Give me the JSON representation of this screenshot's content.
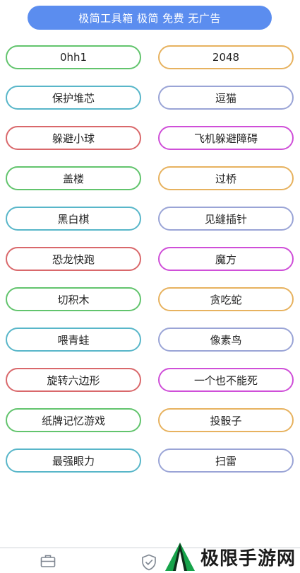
{
  "header": {
    "banner_text": "极简工具箱 极简 免费 无广告"
  },
  "colors": {
    "banner": "#5b8def",
    "green": "#62c46d",
    "orange": "#e7b25f",
    "teal": "#58b6c9",
    "lavender": "#9aa4d6",
    "red": "#d9686b",
    "magenta": "#cf4fd8"
  },
  "games": [
    {
      "label": "0hh1",
      "color": "green"
    },
    {
      "label": "2048",
      "color": "orange"
    },
    {
      "label": "保护堆芯",
      "color": "teal"
    },
    {
      "label": "逗猫",
      "color": "lavender"
    },
    {
      "label": "躲避小球",
      "color": "red"
    },
    {
      "label": "飞机躲避障碍",
      "color": "magenta"
    },
    {
      "label": "盖楼",
      "color": "green"
    },
    {
      "label": "过桥",
      "color": "orange"
    },
    {
      "label": "黑白棋",
      "color": "teal"
    },
    {
      "label": "见缝插针",
      "color": "lavender"
    },
    {
      "label": "恐龙快跑",
      "color": "red"
    },
    {
      "label": "魔方",
      "color": "magenta"
    },
    {
      "label": "切积木",
      "color": "green"
    },
    {
      "label": "贪吃蛇",
      "color": "orange"
    },
    {
      "label": "喂青蛙",
      "color": "teal"
    },
    {
      "label": "像素鸟",
      "color": "lavender"
    },
    {
      "label": "旋转六边形",
      "color": "red"
    },
    {
      "label": "一个也不能死",
      "color": "magenta"
    },
    {
      "label": "纸牌记忆游戏",
      "color": "green"
    },
    {
      "label": "投骰子",
      "color": "orange"
    },
    {
      "label": "最强眼力",
      "color": "teal"
    },
    {
      "label": "扫雷",
      "color": "lavender"
    }
  ],
  "bottom_nav": {
    "icons": [
      "toolbox-icon",
      "shield-check-icon"
    ]
  },
  "watermark": {
    "text": "极限手游网",
    "logo": "triangle-logo"
  }
}
